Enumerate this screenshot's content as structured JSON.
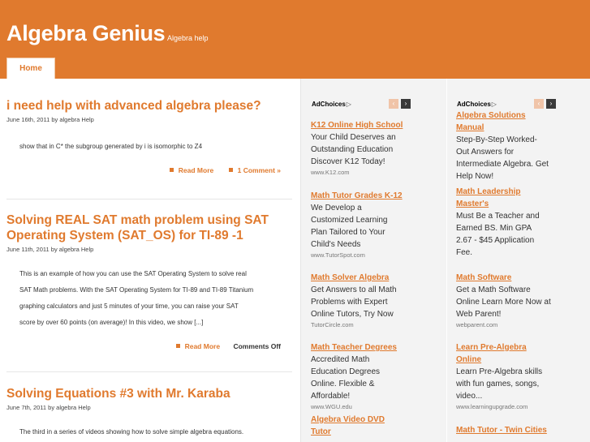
{
  "header": {
    "site_title": "Algebra Genius",
    "tagline": "Algebra help",
    "nav": {
      "home": "Home"
    }
  },
  "posts": [
    {
      "title": "i need help with advanced algebra please?",
      "meta": "June 16th, 2011 by algebra Help",
      "excerpt": [
        "show that in C* the subgroup generated by i is isomorphic to Z4"
      ],
      "read_more": "Read More",
      "comments": "1 Comment »"
    },
    {
      "title": [
        "Solving REAL SAT math problem using SAT",
        "Operating System (SAT_OS) for TI-89 -1"
      ],
      "meta": "June 11th, 2011 by algebra Help",
      "excerpt": [
        "This is an example of how you can use the SAT Operating System to solve real",
        "SAT Math problems. With the SAT Operating System for TI-89 and TI-89 Titanium",
        "graphing calculators and just 5 minutes of your time, you can raise your SAT",
        "score by over 60 points (on average)! In this video, we show [...]"
      ],
      "read_more": "Read More",
      "comments": "Comments Off"
    },
    {
      "title": "Solving Equations #3 with Mr. Karaba",
      "meta": "June 7th, 2011 by algebra Help",
      "excerpt": [
        "The third in a series of videos showing how to solve simple algebra equations."
      ]
    }
  ],
  "sidebar_ads_1": {
    "adchoices": "AdChoices",
    "prev": "‹",
    "next": "›",
    "ads": [
      {
        "title": [
          "K12 Online High School"
        ],
        "body": [
          "Your Child Deserves an",
          "Outstanding Education",
          "Discover K12 Today!"
        ],
        "url": "www.K12.com"
      },
      {
        "title": [
          "Math Tutor Grades K-12"
        ],
        "body": [
          "We Develop a",
          "Customized Learning",
          "Plan Tailored to Your",
          "Child's Needs"
        ],
        "url": "www.TutorSpot.com"
      },
      {
        "title": [
          "Math Solver Algebra"
        ],
        "body": [
          "Get Answers to all Math",
          "Problems with Expert",
          "Online Tutors, Try Now"
        ],
        "url": "TutorCircle.com"
      },
      {
        "title": [
          "Math Teacher Degrees"
        ],
        "body": [
          "Accredited Math",
          "Education Degrees",
          "Online. Flexible &",
          "Affordable!"
        ],
        "url": "www.WGU.edu"
      },
      {
        "title": [
          "Algebra Video DVD",
          "Tutor"
        ],
        "body": [],
        "url": ""
      }
    ]
  },
  "sidebar_ads_2": {
    "adchoices": "AdChoices",
    "prev": "‹",
    "next": "›",
    "ads": [
      {
        "title": [
          "Algebra Solutions",
          "Manual"
        ],
        "body": [
          "Step-By-Step Worked-",
          "Out Answers for",
          "Intermediate Algebra. Get",
          "Help Now!"
        ],
        "url": ""
      },
      {
        "title": [
          "Math Leadership",
          "Master's"
        ],
        "body": [
          "Must Be a Teacher and",
          "Earned BS. Min GPA",
          "2.67 - $45 Application",
          "Fee."
        ],
        "url": ""
      },
      {
        "title": [
          "Math Software"
        ],
        "body": [
          "Get a Math Software",
          "Online Learn More Now at",
          "Web Parent!"
        ],
        "url": "webparent.com"
      },
      {
        "title": [
          "Learn Pre-Algebra",
          "Online"
        ],
        "body": [
          "Learn Pre-Algebra skills",
          "with fun games, songs,",
          "video..."
        ],
        "url": "www.learningupgrade.com"
      },
      {
        "title": [
          "Math Tutor - Twin Cities"
        ],
        "body": [],
        "url": ""
      }
    ]
  }
}
